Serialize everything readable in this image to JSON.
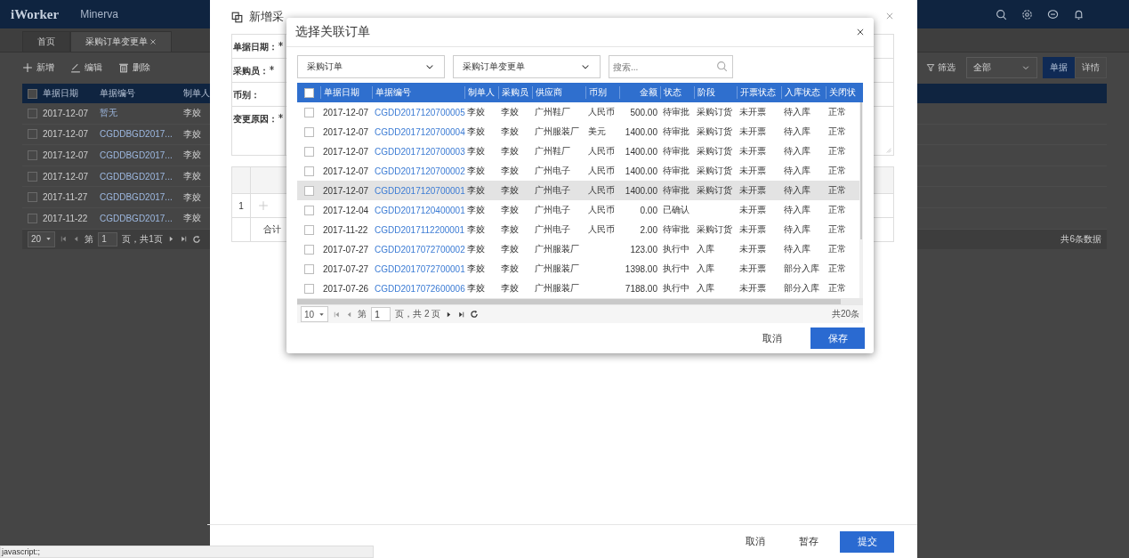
{
  "app_header": {
    "logo": "iWorker",
    "workspace": "Minerva"
  },
  "page_tabs": [
    {
      "label": "首页",
      "selected": false,
      "closable": false
    },
    {
      "label": "采购订单变更单",
      "selected": true,
      "closable": true
    }
  ],
  "toolbar": {
    "actions": [
      {
        "label": "新增",
        "kind": "plus"
      },
      {
        "label": "编辑",
        "kind": "edit"
      },
      {
        "label": "删除",
        "kind": "trash"
      }
    ],
    "filter_label": "筛选",
    "filter_value": "全部",
    "view_toggle": [
      {
        "label": "单据",
        "selected": true
      },
      {
        "label": "详情",
        "selected": false
      }
    ]
  },
  "list_table": {
    "header_checked": false,
    "columns": [
      "单据日期",
      "单据编号",
      "制单人"
    ],
    "rows": [
      {
        "checked": false,
        "cells": [
          "2017-12-07",
          "暂无",
          "李姣"
        ]
      },
      {
        "checked": false,
        "cells": [
          "2017-12-07",
          "CGDDBGD2017...",
          "李姣"
        ]
      },
      {
        "checked": false,
        "cells": [
          "2017-12-07",
          "CGDDBGD2017...",
          "李姣"
        ]
      },
      {
        "checked": false,
        "cells": [
          "2017-12-07",
          "CGDDBGD2017...",
          "李姣"
        ]
      },
      {
        "checked": false,
        "cells": [
          "2017-11-27",
          "CGDDBGD2017...",
          "李姣"
        ]
      },
      {
        "checked": false,
        "cells": [
          "2017-11-22",
          "CGDDBGD2017...",
          "李姣"
        ]
      }
    ]
  },
  "list_pager": {
    "page_size": "20",
    "page_prefix": "第",
    "page": "1",
    "page_suffix": "页，共1页",
    "total": "共6条数据"
  },
  "drawer": {
    "title": "新增采",
    "fields": [
      {
        "label": "单据日期：",
        "required": true,
        "kind": "input"
      },
      {
        "label": "采购员：",
        "required": true,
        "kind": "input"
      },
      {
        "label": "币别：",
        "required": false,
        "kind": "input"
      },
      {
        "label": "变更原因：",
        "required": true,
        "kind": "textarea"
      }
    ],
    "detail": {
      "row_number": "1",
      "total_label": "合计"
    },
    "buttons": [
      {
        "label": "取消",
        "kind": "text"
      },
      {
        "label": "暂存",
        "kind": "text"
      },
      {
        "label": "提交",
        "kind": "primary"
      }
    ]
  },
  "dialog": {
    "title": "选择关联订单",
    "selects": [
      "采购订单",
      "采购订单变更单"
    ],
    "search_placeholder": "搜索...",
    "header_checked": false,
    "columns": [
      "单据日期",
      "单据编号",
      "制单人",
      "采购员",
      "供应商",
      "币别",
      "金额",
      "状态",
      "阶段",
      "开票状态",
      "入库状态",
      "关闭状"
    ],
    "rows": [
      {
        "checked": false,
        "highlighted": false,
        "cells": [
          "2017-12-07",
          "CGDD2017120700005",
          "李姣",
          "李姣",
          "广州鞋厂",
          "人民币",
          "500.00",
          "待审批",
          "采购订货",
          "未开票",
          "待入库",
          "正常"
        ]
      },
      {
        "checked": false,
        "highlighted": false,
        "cells": [
          "2017-12-07",
          "CGDD2017120700004",
          "李姣",
          "李姣",
          "广州服装厂",
          "美元",
          "1400.00",
          "待审批",
          "采购订货",
          "未开票",
          "待入库",
          "正常"
        ]
      },
      {
        "checked": false,
        "highlighted": false,
        "cells": [
          "2017-12-07",
          "CGDD2017120700003",
          "李姣",
          "李姣",
          "广州鞋厂",
          "人民币",
          "1400.00",
          "待审批",
          "采购订货",
          "未开票",
          "待入库",
          "正常"
        ]
      },
      {
        "checked": false,
        "highlighted": false,
        "cells": [
          "2017-12-07",
          "CGDD2017120700002",
          "李姣",
          "李姣",
          "广州电子",
          "人民币",
          "1400.00",
          "待审批",
          "采购订货",
          "未开票",
          "待入库",
          "正常"
        ]
      },
      {
        "checked": false,
        "highlighted": true,
        "cells": [
          "2017-12-07",
          "CGDD2017120700001",
          "李姣",
          "李姣",
          "广州电子",
          "人民币",
          "1400.00",
          "待审批",
          "采购订货",
          "未开票",
          "待入库",
          "正常"
        ]
      },
      {
        "checked": false,
        "highlighted": false,
        "cells": [
          "2017-12-04",
          "CGDD2017120400001",
          "李姣",
          "李姣",
          "广州电子",
          "人民币",
          "0.00",
          "已确认",
          null,
          "未开票",
          "待入库",
          "正常"
        ]
      },
      {
        "checked": false,
        "highlighted": false,
        "cells": [
          "2017-11-22",
          "CGDD2017112200001",
          "李姣",
          "李姣",
          "广州电子",
          "人民币",
          "2.00",
          "待审批",
          "采购订货",
          "未开票",
          "待入库",
          "正常"
        ]
      },
      {
        "checked": false,
        "highlighted": false,
        "cells": [
          "2017-07-27",
          "CGDD2017072700002",
          "李姣",
          "李姣",
          "广州服装厂",
          null,
          "123.00",
          "执行中",
          "入库",
          "未开票",
          "待入库",
          "正常"
        ]
      },
      {
        "checked": false,
        "highlighted": false,
        "cells": [
          "2017-07-27",
          "CGDD2017072700001",
          "李姣",
          "李姣",
          "广州服装厂",
          null,
          "1398.00",
          "执行中",
          "入库",
          "未开票",
          "部分入库",
          "正常"
        ]
      },
      {
        "checked": false,
        "highlighted": false,
        "cells": [
          "2017-07-26",
          "CGDD2017072600006",
          "李姣",
          "李姣",
          "广州服装厂",
          null,
          "7188.00",
          "执行中",
          "入库",
          "未开票",
          "部分入库",
          "正常"
        ]
      }
    ],
    "pager": {
      "page_size": "10",
      "page_prefix": "第",
      "page": "1",
      "page_suffix": "页，共 2 页",
      "total": "共20条"
    },
    "buttons": [
      {
        "label": "取消",
        "kind": "text"
      },
      {
        "label": "保存",
        "kind": "primary"
      }
    ]
  },
  "status_url": "javascript:;"
}
